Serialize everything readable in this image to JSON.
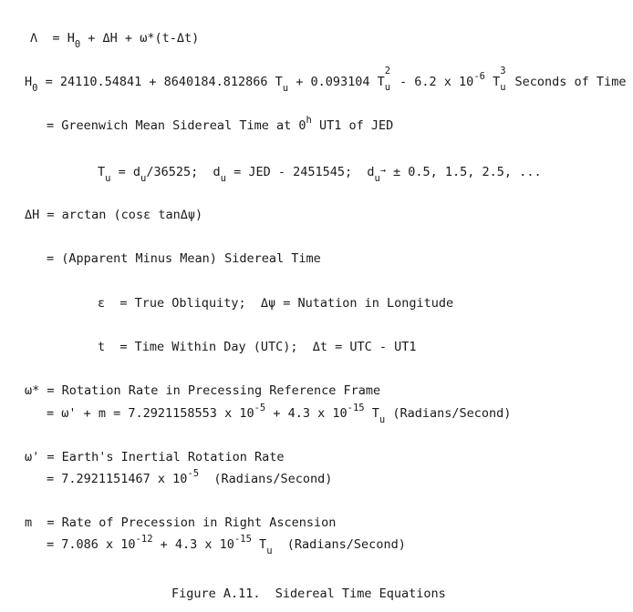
{
  "figure_caption": "Figure A.11.  Sidereal Time Equations",
  "symbols": {
    "Lambda": "Λ",
    "H0": "H",
    "H0_sub": "0",
    "eq": "=",
    "plus": "+",
    "minus": "-",
    "dH": "ΔH",
    "omega_star": "ω*",
    "omega_prime": "ω'",
    "m": "m",
    "t": "t",
    "eps": "ε",
    "dpsi": "Δψ",
    "dt": "Δt",
    "T": "T",
    "u": "u",
    "d": "d",
    "two": "2",
    "three": "3",
    "h": "h"
  },
  "eq1": {
    "rhs": "H",
    "sub0": "0",
    "mid": "+ ΔH + ω*(t-Δt)"
  },
  "eq2": {
    "a": "24110.54841 + 8640184.812866 T",
    "b": "+ 0.093104 T",
    "c": "- 6.2 x 10",
    "exp": "-6",
    "d": "T",
    "e": "Seconds of Time"
  },
  "eq3": {
    "text": "= Greenwich Mean Sidereal Time at 0",
    "h": "h",
    "rest": "UT1 of JED"
  },
  "eq4": {
    "a": "T",
    "b": "= d",
    "c": "/36525;  d",
    "d": "= JED - 2451545;  d",
    "e": "± 0.5, 1.5, 2.5, ...",
    "arrow": "→"
  },
  "eq5": {
    "lhs": "ΔH",
    "rhs": "= arctan (cosε tanΔψ)"
  },
  "eq6": {
    "text": "= (Apparent Minus Mean) Sidereal Time"
  },
  "eq7": {
    "eps": "ε",
    "a": "= True Obliquity;",
    "dpsi": "Δψ",
    "b": "= Nutation in Longitude"
  },
  "eq8": {
    "t": "t",
    "a": "= Time Within Day (UTC);",
    "dt": "Δt",
    "b": "= UTC - UT1"
  },
  "eq9": {
    "lhs": "ω*",
    "a": "= Rotation Rate in Precessing Reference Frame"
  },
  "eq10": {
    "a": "= ω' + m = 7.2921158553 x 10",
    "exp1": "-5",
    "b": "+ 4.3 x 10",
    "exp2": "-15",
    "c": "T",
    "d": "(Radians/Second)"
  },
  "eq11": {
    "lhs": "ω'",
    "a": "= Earth's Inertial Rotation Rate"
  },
  "eq12": {
    "a": "= 7.2921151467 x 10",
    "exp": "-5",
    "b": "(Radians/Second)"
  },
  "eq13": {
    "lhs": "m",
    "a": "= Rate of Precession in Right Ascension"
  },
  "eq14": {
    "a": "= 7.086 x 10",
    "exp1": "-12",
    "b": "+ 4.3 x 10",
    "exp2": "-15",
    "c": "T",
    "d": "(Radians/Second)"
  }
}
